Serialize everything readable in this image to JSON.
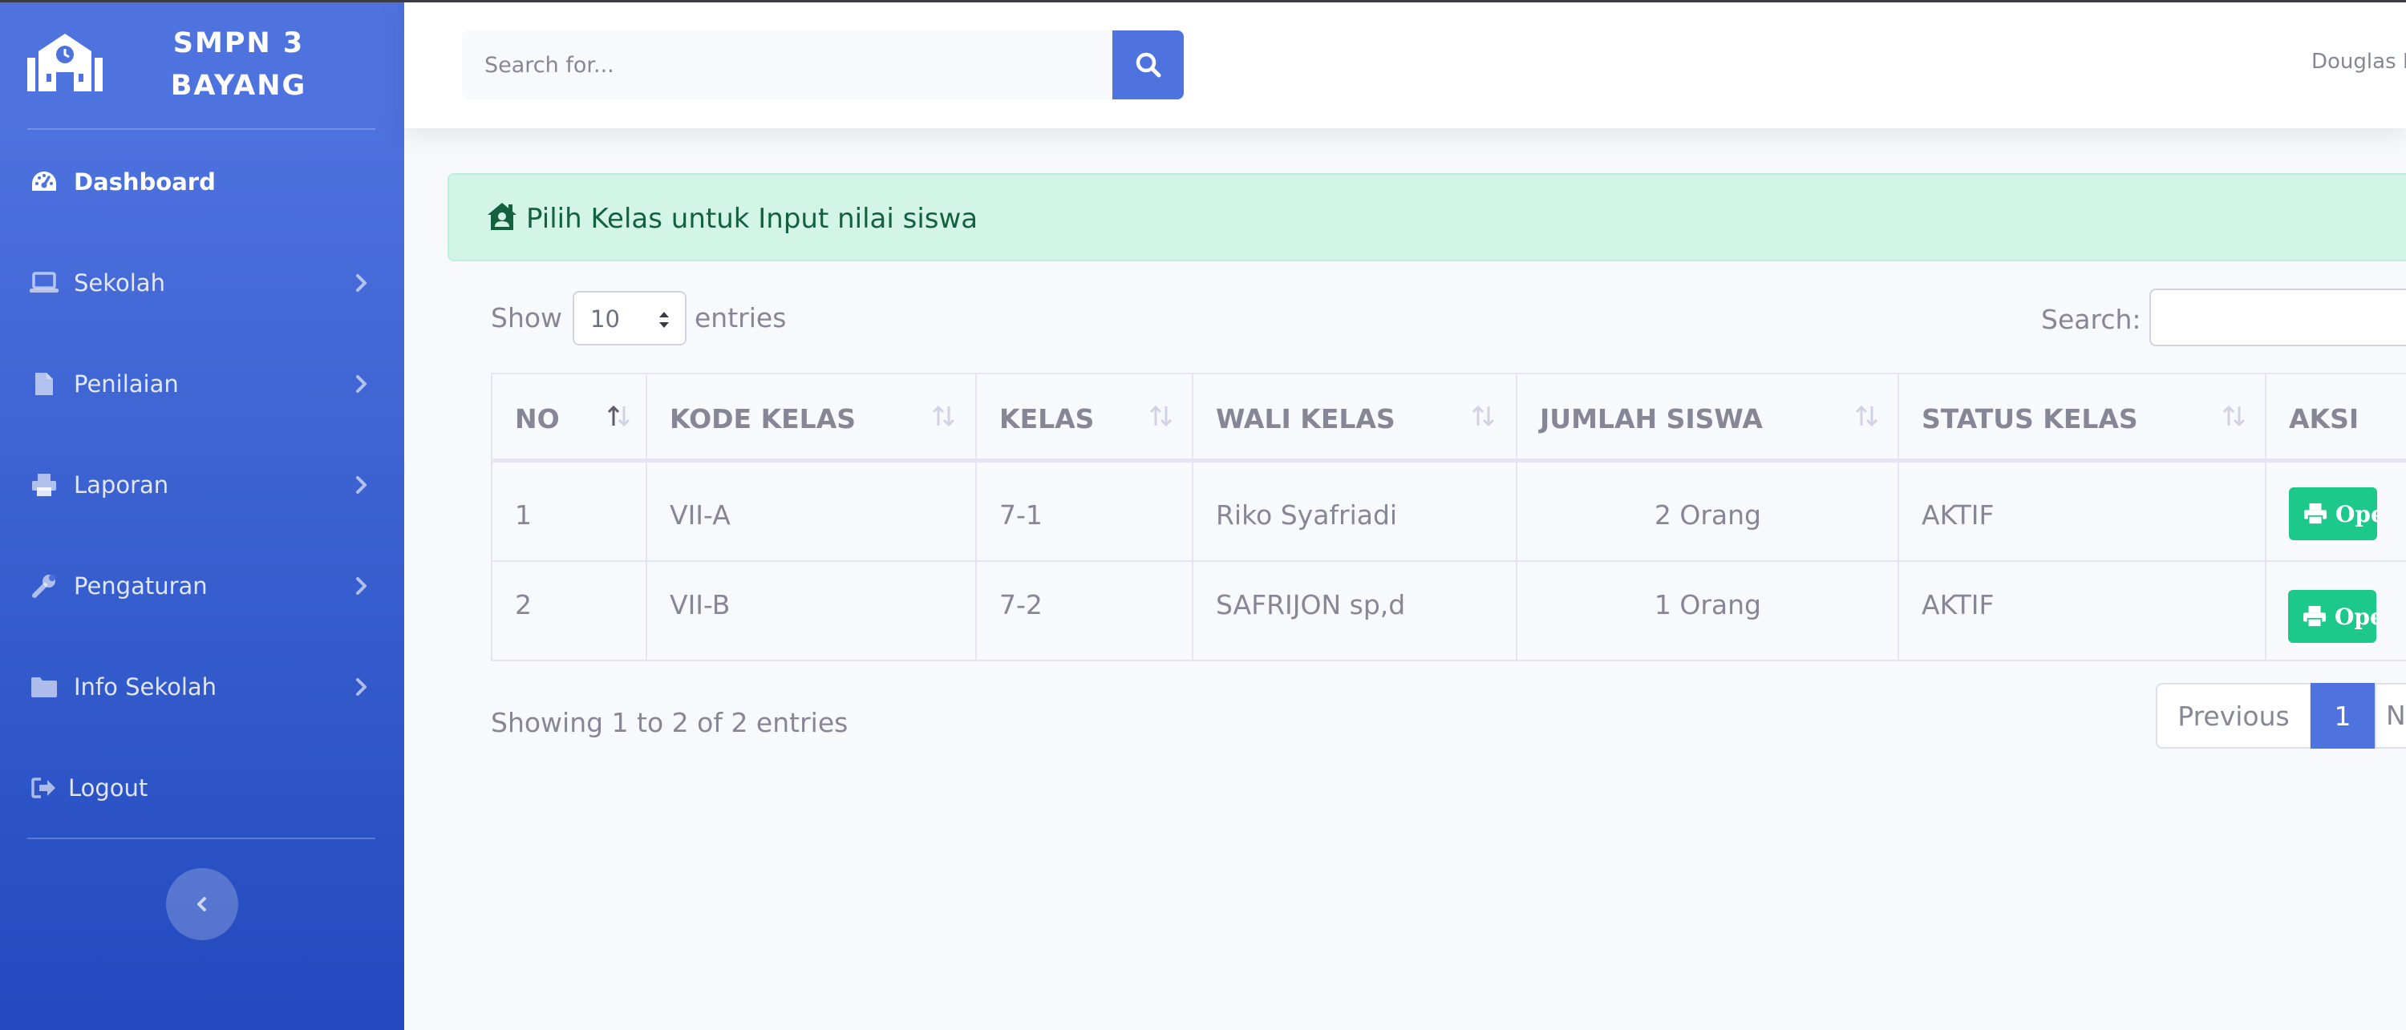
{
  "brand": {
    "line1": "SMPN 3",
    "line2": "BAYANG"
  },
  "sidebar": {
    "items": [
      {
        "label": "Dashboard",
        "icon": "tachometer-icon",
        "active": true
      },
      {
        "label": "Sekolah",
        "icon": "laptop-icon"
      },
      {
        "label": "Penilaian",
        "icon": "file-icon"
      },
      {
        "label": "Laporan",
        "icon": "print-icon"
      },
      {
        "label": "Pengaturan",
        "icon": "wrench-icon"
      },
      {
        "label": "Info Sekolah",
        "icon": "folder-icon"
      },
      {
        "label": "Logout",
        "icon": "sign-out-icon"
      }
    ]
  },
  "topbar": {
    "search_placeholder": "Search for...",
    "user_name": "Douglas M"
  },
  "alert": {
    "text": "Pilih Kelas untuk Input nilai siswa"
  },
  "controls": {
    "show_label": "Show",
    "entries_value": "10",
    "entries_label": "entries",
    "search_label": "Search:"
  },
  "table": {
    "headers": [
      "NO",
      "KODE KELAS",
      "KELAS",
      "WALI KELAS",
      "JUMLAH SISWA",
      "STATUS KELAS",
      "AKSI"
    ],
    "rows": [
      {
        "no": "1",
        "kode": "VII-A",
        "kelas": "7-1",
        "wali": "Riko Syafriadi",
        "jumlah": "2 Orang",
        "status": "AKTIF",
        "aksi": "Open"
      },
      {
        "no": "2",
        "kode": "VII-B",
        "kelas": "7-2",
        "wali": "SAFRIJON sp,d",
        "jumlah": "1 Orang",
        "status": "AKTIF",
        "aksi": "Open"
      }
    ]
  },
  "footer": {
    "showing": "Showing 1 to 2 of 2 entries"
  },
  "pagination": {
    "previous": "Previous",
    "current": "1",
    "next": "Next"
  },
  "colors": {
    "primary": "#4e73df",
    "success": "#1cc88a",
    "alert_bg": "#d3f5e8",
    "alert_text": "#13613f"
  }
}
